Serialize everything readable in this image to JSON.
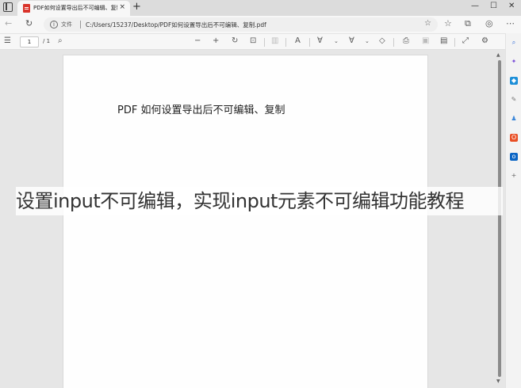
{
  "browser": {
    "tab": {
      "title": "PDF如何设置导出后不可编辑、复制",
      "close_label": "×"
    },
    "newtab_label": "+",
    "window": {
      "minimize": "—",
      "maximize": "☐",
      "close": "✕"
    },
    "nav": {
      "back": "←",
      "refresh": "↻"
    },
    "address": {
      "label": "文件",
      "url": "C:/Users/15237/Desktop/PDF如何设置导出后不可编辑、复制.pdf"
    }
  },
  "pdf_toolbar": {
    "page_current": "1",
    "page_total": "/ 1",
    "icons": [
      "contents-icon",
      "search-icon",
      "zoom-out-icon",
      "zoom-in-icon",
      "rotate-icon",
      "fit-page-icon",
      "two-page-icon",
      "read-aloud-icon",
      "draw-icon",
      "highlight-icon",
      "erase-icon",
      "print-icon",
      "save-icon",
      "save-as-icon",
      "fullscreen-icon",
      "settings-icon"
    ]
  },
  "document": {
    "heading": "PDF 如何设置导出后不可编辑、复制"
  },
  "sidebar_icons": [
    "search-icon",
    "copilot-icon",
    "shopping-icon",
    "tools-icon",
    "games-icon",
    "office-icon",
    "outlook-icon",
    "add-icon"
  ],
  "caption": "设置input不可编辑，实现input元素不可编辑功能教程",
  "colors": {
    "pdf_favicon": "#d9342b",
    "office": "#e94f25",
    "outlook": "#0a64c4",
    "copilot": "#2f6bd8"
  }
}
